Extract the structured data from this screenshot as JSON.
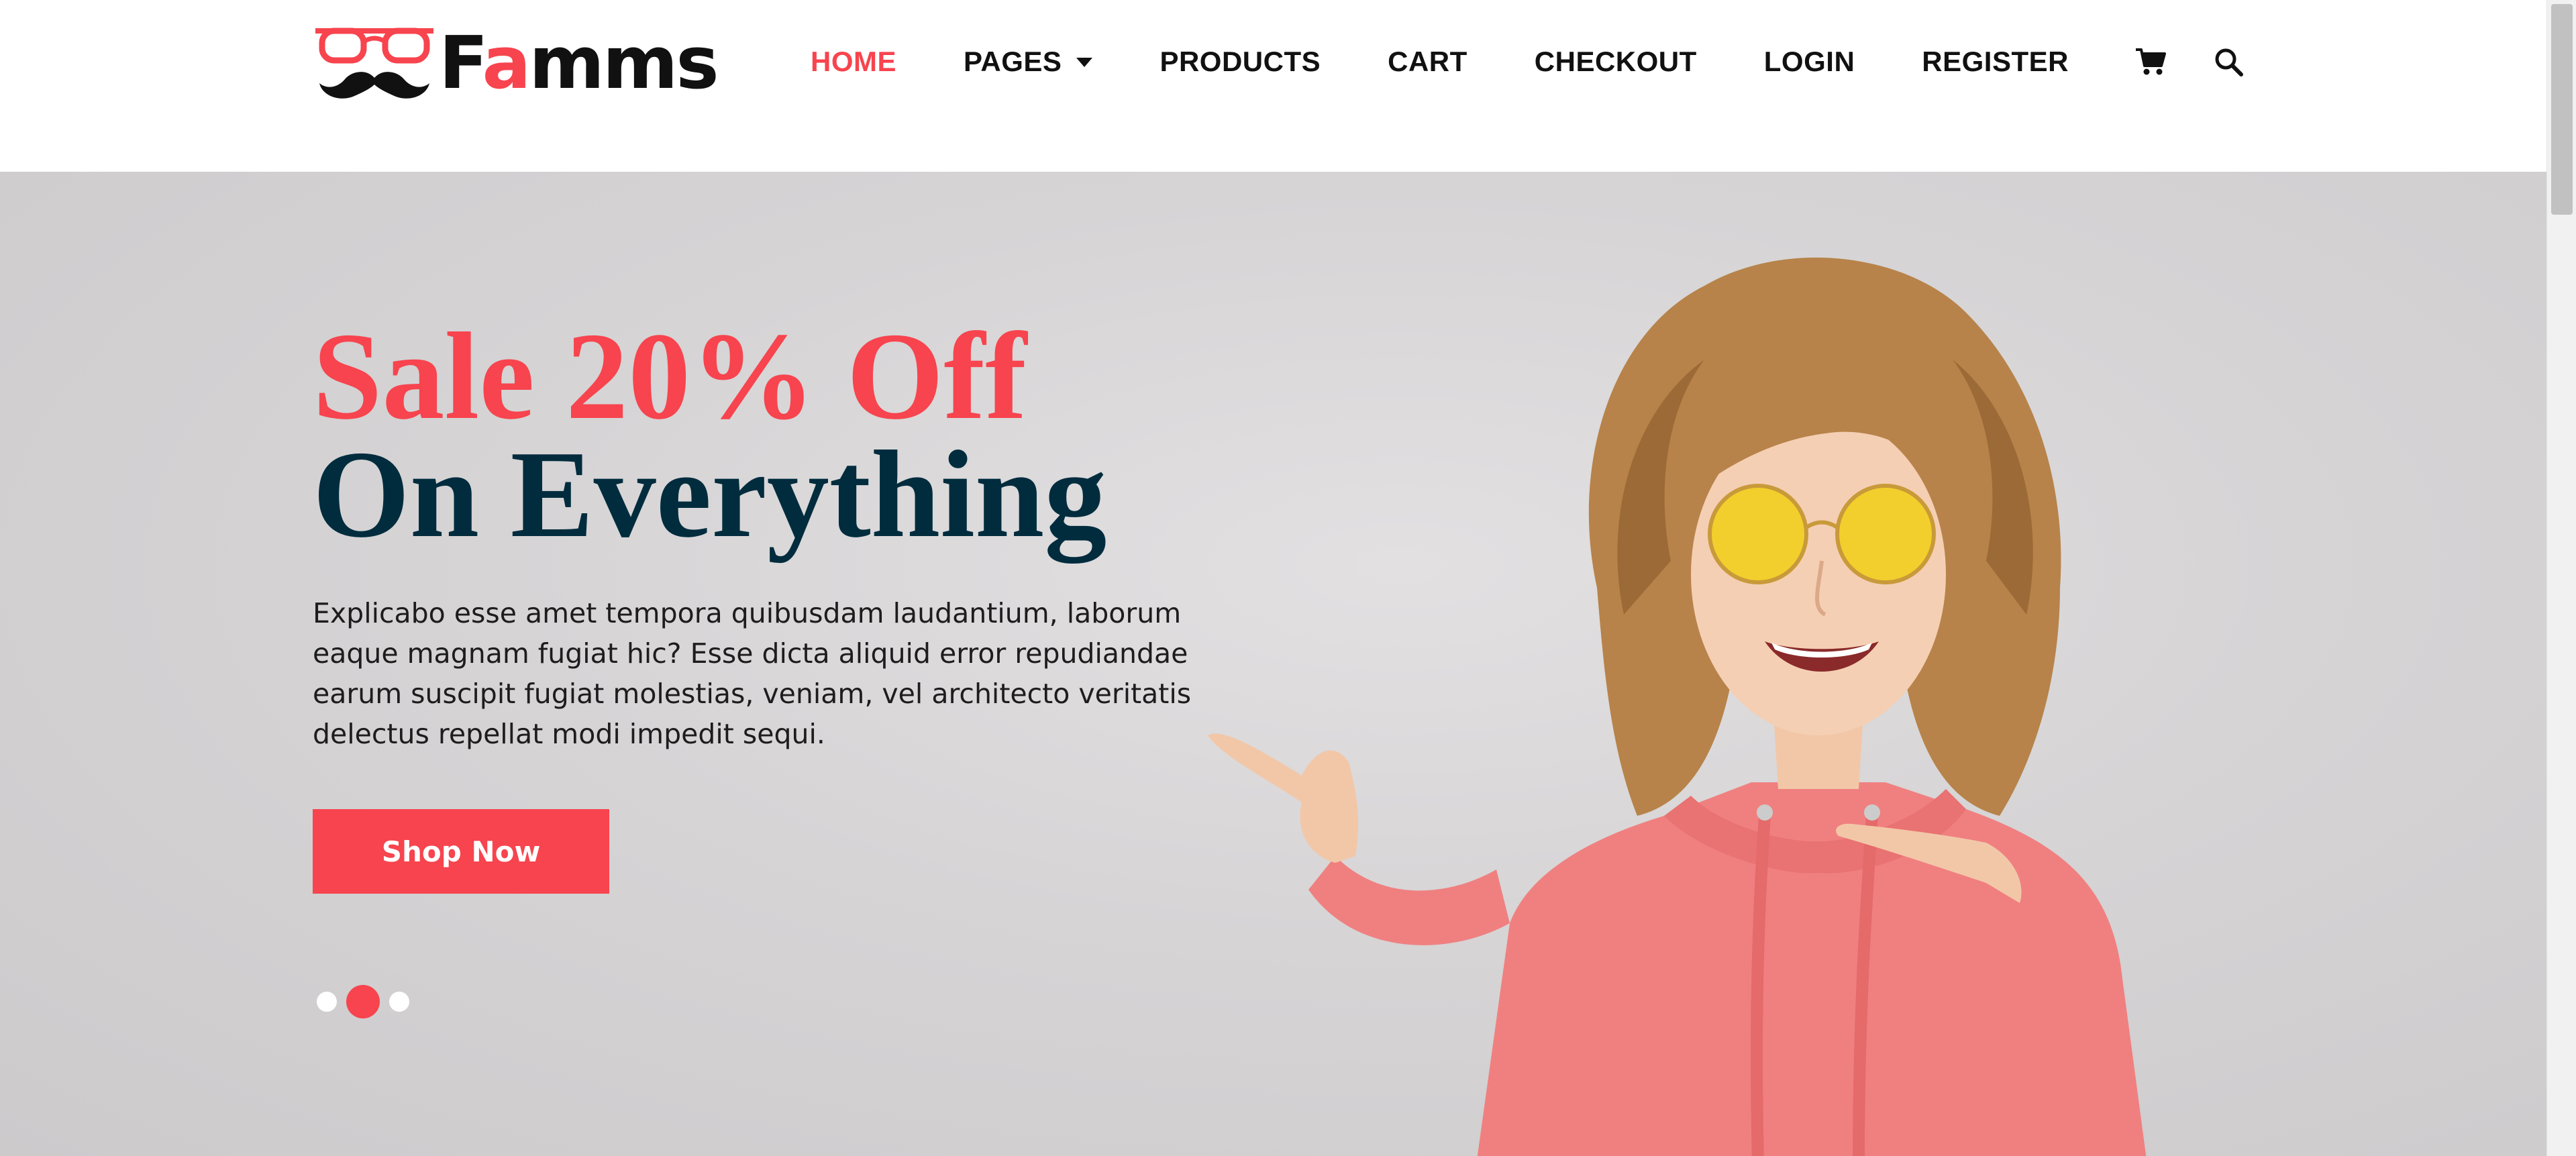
{
  "brand": {
    "name_part1": "F",
    "name_accent": "a",
    "name_part2": "mms",
    "accent_color": "#f7444e"
  },
  "nav": {
    "items": [
      {
        "label": "HOME",
        "active": true
      },
      {
        "label": "PAGES",
        "has_dropdown": true
      },
      {
        "label": "PRODUCTS"
      },
      {
        "label": "CART"
      },
      {
        "label": "CHECKOUT"
      },
      {
        "label": "LOGIN"
      },
      {
        "label": "REGISTER"
      }
    ],
    "icons": [
      "cart-icon",
      "search-icon"
    ]
  },
  "hero": {
    "headline_line1": "Sale 20% Off",
    "headline_line2": "On Everything",
    "description": "Explicabo esse amet tempora quibusdam laudantium, laborum eaque magnam fugiat hic? Esse dicta aliquid error repudiandae earum suscipit fugiat molestias, veniam, vel architecto veritatis delectus repellat modi impedit sequi.",
    "cta_label": "Shop Now",
    "slides_total": 3,
    "active_slide": 2,
    "headline_color_1": "#f7444e",
    "headline_color_2": "#002c3e"
  }
}
